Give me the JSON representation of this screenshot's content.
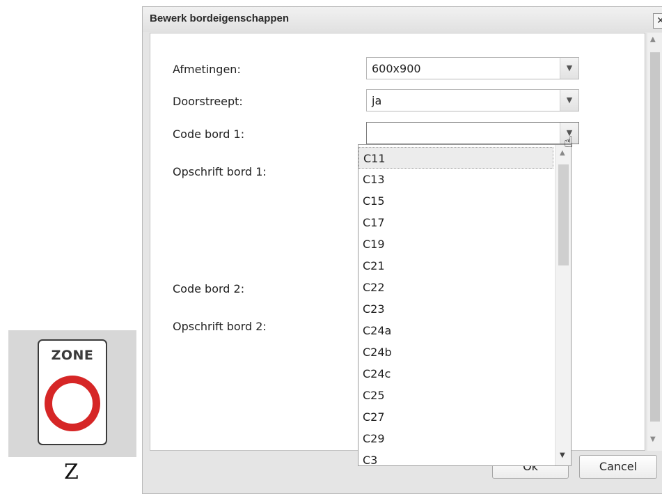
{
  "preview": {
    "sign_text": "ZONE",
    "label": "Z",
    "ring_color": "#d62626"
  },
  "dialog": {
    "title": "Bewerk bordeigenschappen",
    "close_label": "✕"
  },
  "form": {
    "afmetingen_label": "Afmetingen:",
    "afmetingen_value": "600x900",
    "doorstreept_label": "Doorstreept:",
    "doorstreept_value": "ja",
    "code1_label": "Code bord 1:",
    "code1_value": "",
    "opschrift1_label": "Opschrift bord 1:",
    "code2_label": "Code bord 2:",
    "opschrift2_label": "Opschrift bord 2:"
  },
  "dropdown": {
    "items": [
      "C11",
      "C13",
      "C15",
      "C17",
      "C19",
      "C21",
      "C22",
      "C23",
      "C24a",
      "C24b",
      "C24c",
      "C25",
      "C27",
      "C29",
      "C3"
    ],
    "selected": "C11"
  },
  "buttons": {
    "ok": "Ok",
    "cancel": "Cancel"
  }
}
